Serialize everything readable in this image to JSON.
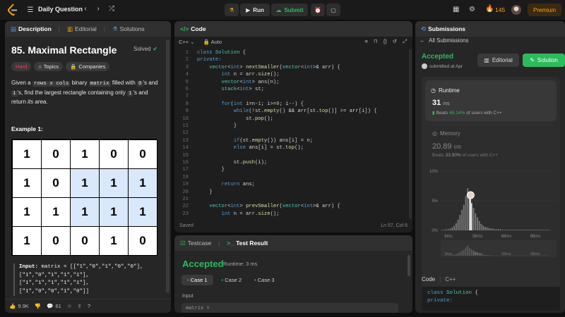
{
  "topbar": {
    "problem_list": "Daily Question",
    "run": "Run",
    "submit": "Submit",
    "streak": "145",
    "premium": "Premium"
  },
  "description": {
    "tabs": [
      "Description",
      "Editorial",
      "Solutions"
    ],
    "title": "85. Maximal Rectangle",
    "solved": "Solved",
    "difficulty": "Hard",
    "topics": "Topics",
    "companies": "Companies",
    "text_1": "Given a",
    "code_1": "rows x cols",
    "text_2": "binary",
    "code_2": "matrix",
    "text_3": "filled with",
    "code_3": "0",
    "text_4": "'s and",
    "code_4": "1",
    "text_5": "'s, find the largest rectangle containing only",
    "code_5": "1",
    "text_6": "'s and return",
    "text_7": "its area",
    "text_8": ".",
    "example_heading": "Example 1:",
    "matrix": [
      [
        "1",
        "0",
        "1",
        "0",
        "0"
      ],
      [
        "1",
        "0",
        "1",
        "1",
        "1"
      ],
      [
        "1",
        "1",
        "1",
        "1",
        "1"
      ],
      [
        "1",
        "0",
        "0",
        "1",
        "0"
      ]
    ],
    "highlighted": [
      [
        1,
        2
      ],
      [
        1,
        3
      ],
      [
        1,
        4
      ],
      [
        2,
        2
      ],
      [
        2,
        3
      ],
      [
        2,
        4
      ]
    ],
    "input_label": "Input:",
    "input_lines": [
      "matrix = [[\"1\",\"0\",\"1\",\"0\",\"0\"],",
      "[\"1\",\"0\",\"1\",\"1\",\"1\"],",
      "[\"1\",\"1\",\"1\",\"1\",\"1\"],",
      "[\"1\",\"0\",\"0\",\"1\",\"0\"]]"
    ],
    "likes": "9.9K",
    "comments": "61"
  },
  "code": {
    "title": "Code",
    "language": "C++",
    "mode": "Auto",
    "status": "Saved",
    "cursor": "Ln 57, Col 6",
    "start_line": 1,
    "lines": [
      [
        [
          "kw",
          "class "
        ],
        [
          "ty",
          "Solution "
        ],
        [
          "tx",
          "{"
        ]
      ],
      [
        [
          "kw",
          "private:"
        ]
      ],
      [
        [
          "tx",
          "    "
        ],
        [
          "ty",
          "vector"
        ],
        [
          "tx",
          "<"
        ],
        [
          "kw",
          "int"
        ],
        [
          "tx",
          "> "
        ],
        [
          "fn",
          "nextSmaller"
        ],
        [
          "tx",
          "("
        ],
        [
          "ty",
          "vector"
        ],
        [
          "tx",
          "<"
        ],
        [
          "kw",
          "int"
        ],
        [
          "tx",
          ">& arr) {"
        ]
      ],
      [
        [
          "tx",
          "        "
        ],
        [
          "kw",
          "int "
        ],
        [
          "tx",
          "n = arr."
        ],
        [
          "fn",
          "size"
        ],
        [
          "tx",
          "();"
        ]
      ],
      [
        [
          "tx",
          "        "
        ],
        [
          "ty",
          "vector"
        ],
        [
          "tx",
          "<"
        ],
        [
          "kw",
          "int"
        ],
        [
          "tx",
          "> ans(n);"
        ]
      ],
      [
        [
          "tx",
          "        "
        ],
        [
          "ty",
          "stack"
        ],
        [
          "tx",
          "<"
        ],
        [
          "kw",
          "int"
        ],
        [
          "tx",
          "> st;"
        ]
      ],
      [
        [
          "tx",
          ""
        ]
      ],
      [
        [
          "tx",
          "        "
        ],
        [
          "kw",
          "for"
        ],
        [
          "tx",
          "("
        ],
        [
          "kw",
          "int "
        ],
        [
          "tx",
          "i=n-"
        ],
        [
          "nu",
          "1"
        ],
        [
          "tx",
          "; i>="
        ],
        [
          "nu",
          "0"
        ],
        [
          "tx",
          "; i--) {"
        ]
      ],
      [
        [
          "tx",
          "            "
        ],
        [
          "kw",
          "while"
        ],
        [
          "tx",
          "(!st."
        ],
        [
          "fn",
          "empty"
        ],
        [
          "tx",
          "() && arr[st."
        ],
        [
          "fn",
          "top"
        ],
        [
          "tx",
          "()] >= arr[i]) {"
        ]
      ],
      [
        [
          "tx",
          "                st."
        ],
        [
          "fn",
          "pop"
        ],
        [
          "tx",
          "();"
        ]
      ],
      [
        [
          "tx",
          "            }"
        ]
      ],
      [
        [
          "tx",
          ""
        ]
      ],
      [
        [
          "tx",
          "            "
        ],
        [
          "kw",
          "if"
        ],
        [
          "tx",
          "(st."
        ],
        [
          "fn",
          "empty"
        ],
        [
          "tx",
          "()) ans[i] = n;"
        ]
      ],
      [
        [
          "tx",
          "            "
        ],
        [
          "kw",
          "else "
        ],
        [
          "tx",
          "ans[i] = st."
        ],
        [
          "fn",
          "top"
        ],
        [
          "tx",
          "();"
        ]
      ],
      [
        [
          "tx",
          ""
        ]
      ],
      [
        [
          "tx",
          "            st."
        ],
        [
          "fn",
          "push"
        ],
        [
          "tx",
          "(i);"
        ]
      ],
      [
        [
          "tx",
          "        }"
        ]
      ],
      [
        [
          "tx",
          ""
        ]
      ],
      [
        [
          "tx",
          "        "
        ],
        [
          "kw",
          "return "
        ],
        [
          "tx",
          "ans;"
        ]
      ],
      [
        [
          "tx",
          "    }"
        ]
      ],
      [
        [
          "tx",
          ""
        ]
      ],
      [
        [
          "tx",
          "    "
        ],
        [
          "ty",
          "vector"
        ],
        [
          "tx",
          "<"
        ],
        [
          "kw",
          "int"
        ],
        [
          "tx",
          "> "
        ],
        [
          "fn",
          "prevSmaller"
        ],
        [
          "tx",
          "("
        ],
        [
          "ty",
          "vector"
        ],
        [
          "tx",
          "<"
        ],
        [
          "kw",
          "int"
        ],
        [
          "tx",
          ">& arr) {"
        ]
      ],
      [
        [
          "tx",
          "        "
        ],
        [
          "kw",
          "int "
        ],
        [
          "tx",
          "n = arr."
        ],
        [
          "fn",
          "size"
        ],
        [
          "tx",
          "();"
        ]
      ]
    ]
  },
  "result": {
    "testcase_tab": "Testcase",
    "result_tab": "Test Result",
    "status": "Accepted",
    "runtime": "Runtime: 3 ms",
    "cases": [
      "Case 1",
      "Case 2",
      "Case 3"
    ],
    "input_label": "Input",
    "input_preview": "matrix ="
  },
  "submissions": {
    "title": "Submissions",
    "back": "All Submissions",
    "status": "Accepted",
    "submitted": "submitted at Apr",
    "editorial_btn": "Editorial",
    "solution_btn": "Solution",
    "runtime_label": "Runtime",
    "runtime_value": "31",
    "runtime_unit": "ms",
    "beats_runtime_prefix": "Beats",
    "beats_runtime_pct": "65.14%",
    "beats_runtime_suffix": "of users with C++",
    "memory_label": "Memory",
    "memory_value": "20.89",
    "memory_unit": "MB",
    "beats_memory_prefix": "Beats",
    "beats_memory_pct": "33.90%",
    "beats_memory_suffix": "of users with C++",
    "code_label": "Code",
    "code_lang": "C++",
    "code_preview": [
      "class Solution {",
      "private:"
    ]
  },
  "chart_data": {
    "type": "bar",
    "yticks": [
      "10%",
      "5%",
      "0%"
    ],
    "xticks": [
      "8ms",
      "38ms",
      "68ms",
      "98ms"
    ],
    "ylim": [
      0,
      10
    ],
    "xlim": [
      0,
      120
    ],
    "x": [
      2,
      4,
      6,
      8,
      10,
      12,
      14,
      16,
      18,
      20,
      22,
      24,
      26,
      28,
      30,
      32,
      34,
      36,
      38,
      40,
      42,
      44,
      46,
      48,
      50,
      52,
      54,
      56,
      58,
      60,
      62,
      64,
      66,
      68,
      70,
      72,
      74,
      76,
      78,
      80,
      82,
      84,
      86,
      88,
      90,
      92,
      94,
      96,
      98,
      100,
      102,
      104,
      106,
      108,
      110,
      112
    ],
    "values": [
      0.1,
      0.1,
      0.2,
      0.2,
      0.3,
      0.5,
      0.8,
      1.2,
      1.8,
      2.6,
      3.5,
      4.3,
      5.8,
      7.1,
      5.4,
      4.6,
      3.8,
      2.9,
      2.2,
      1.6,
      1.1,
      0.8,
      0.6,
      0.5,
      0.4,
      0.3,
      0.3,
      0.2,
      0.2,
      0.2,
      0.2,
      0.1,
      0.1,
      0.1,
      0.1,
      0.1,
      0.1,
      0.1,
      0.1,
      0.1,
      0.1,
      0.1,
      0.1,
      0.1,
      0.1,
      0.1,
      0.1,
      0.1,
      0.1,
      0.1,
      0.1,
      0.1,
      0.1,
      0.1,
      0.1,
      0.1
    ],
    "highlight_x": 31
  }
}
